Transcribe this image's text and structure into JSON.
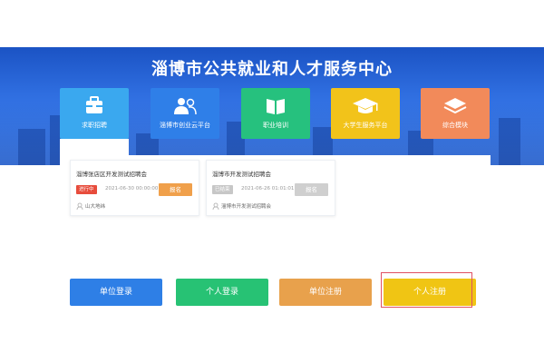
{
  "hero": {
    "title": "淄博市公共就业和人才服务中心"
  },
  "categories": [
    {
      "label": "求职招聘",
      "icon": "briefcase-icon",
      "color": "#3aa8ef"
    },
    {
      "label": "淄博市创业云平台",
      "icon": "people-icon",
      "color": "#2f7fe8"
    },
    {
      "label": "职业培训",
      "icon": "book-icon",
      "color": "#26c17e"
    },
    {
      "label": "大学生服务平台",
      "icon": "graduation-cap-icon",
      "color": "#f2c31a"
    },
    {
      "label": "综合模块",
      "icon": "layers-icon",
      "color": "#f28a5a"
    }
  ],
  "fairs": [
    {
      "title": "淄博张店区开发测试招聘会",
      "status": "进行中",
      "status_color": "#e74c3c",
      "time": "2021-06-30 00:00:00",
      "apply_label": "报名",
      "apply_color": "#f0a04b",
      "location": "山大地纬"
    },
    {
      "title": "淄博市开发测试招聘会",
      "status": "已结束",
      "status_color": "#c7c7c7",
      "time": "2021-06-26 01:01:01",
      "apply_label": "报名",
      "apply_color": "#cfcfcf",
      "location": "淄博市开发测试招聘会"
    }
  ],
  "actions": {
    "unit_login": "单位登录",
    "person_login": "个人登录",
    "unit_register": "单位注册",
    "person_register": "个人注册"
  }
}
